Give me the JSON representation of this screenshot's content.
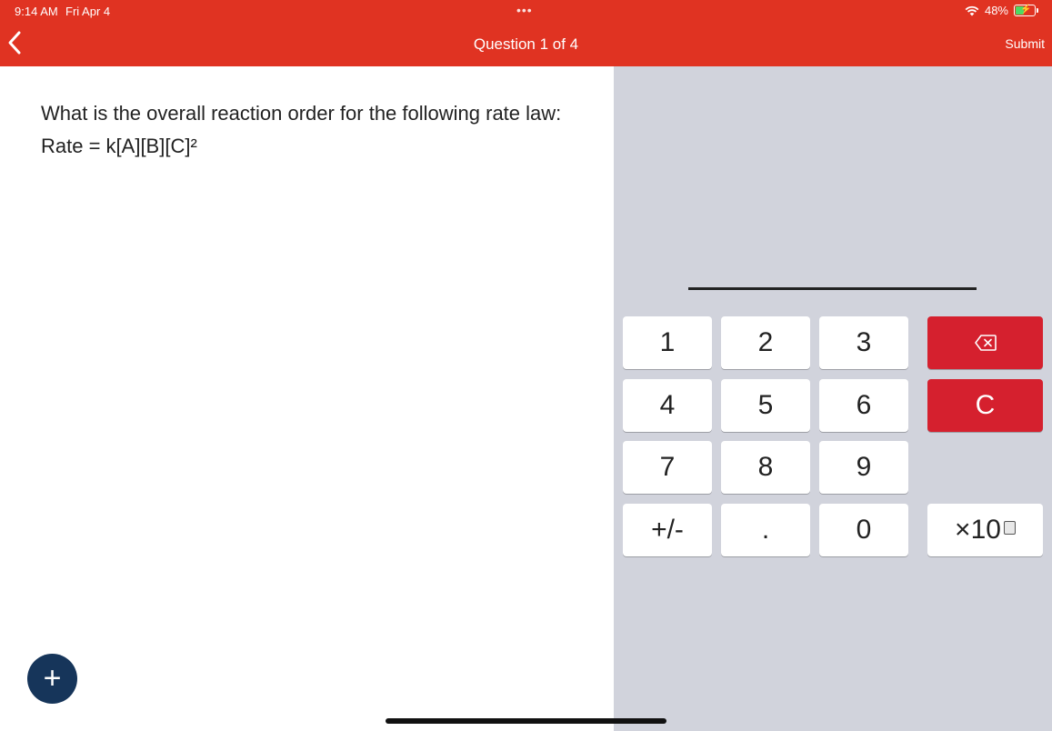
{
  "status_bar": {
    "time": "9:14 AM",
    "date": "Fri Apr 4",
    "multitask_dots": "•••",
    "battery_percent": "48%",
    "battery_level": 0.48,
    "icons": [
      "wifi-icon",
      "battery-charging-icon"
    ]
  },
  "nav": {
    "back_icon": "chevron-left-icon",
    "title": "Question 1 of 4",
    "submit_label": "Submit"
  },
  "question": {
    "line1": "What is the overall reaction order for the following rate law:",
    "line2": "Rate = k[A][B][C]²"
  },
  "keypad": {
    "k1": "1",
    "k2": "2",
    "k3": "3",
    "k4": "4",
    "k5": "5",
    "k6": "6",
    "k7": "7",
    "k8": "8",
    "k9": "9",
    "sign": "+/-",
    "dot": ".",
    "k0": "0",
    "clear": "C",
    "exponent": "×10",
    "backspace_icon": "backspace-icon"
  },
  "fab": {
    "label": "+",
    "icon": "plus-icon"
  },
  "colors": {
    "header": "#e03322",
    "keypad_bg": "#d1d3dc",
    "red_key": "#d5202e",
    "fab": "#16355a"
  }
}
